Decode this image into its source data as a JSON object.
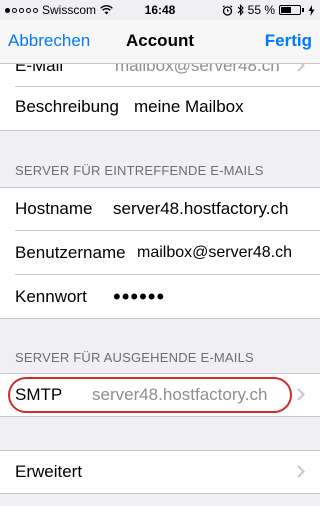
{
  "status": {
    "carrier": "Swisscom",
    "time": "16:48",
    "battery_percent_label": "55 %",
    "battery_level": 0.55
  },
  "nav": {
    "cancel": "Abbrechen",
    "title": "Account",
    "done": "Fertig"
  },
  "account": {
    "email_label": "E-Mail",
    "email_value": "mailbox@server48.ch",
    "description_label": "Beschreibung",
    "description_value": "meine Mailbox"
  },
  "incoming": {
    "header": "SERVER FÜR EINTREFFENDE E-MAILS",
    "hostname_label": "Hostname",
    "hostname_value": "server48.hostfactory.ch",
    "username_label": "Benutzername",
    "username_value": "mailbox@server48.ch",
    "password_label": "Kennwort",
    "password_value": "••••••"
  },
  "outgoing": {
    "header": "SERVER FÜR AUSGEHENDE E-MAILS",
    "smtp_label": "SMTP",
    "smtp_value": "server48.hostfactory.ch"
  },
  "advanced": {
    "label": "Erweitert"
  },
  "colors": {
    "accent": "#007aff",
    "highlight": "#d42a2a"
  }
}
